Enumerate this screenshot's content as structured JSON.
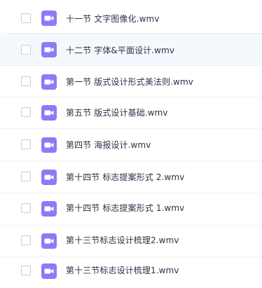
{
  "file_list": {
    "icon": "video-file-icon",
    "icon_color": "#8b7cf6",
    "highlight_color": "#f5f9fe",
    "files": [
      {
        "name": "十一节 文字图像化.wmv"
      },
      {
        "name": "十二节 字体&平面设计.wmv",
        "highlighted": true
      },
      {
        "name": "第一节 版式设计形式美法则.wmv"
      },
      {
        "name": "第五节 版式设计基础.wmv"
      },
      {
        "name": "第四节 海报设计.wmv"
      },
      {
        "name": "第十四节 标志提案形式 2.wmv"
      },
      {
        "name": "第十四节 标志提案形式 1.wmv"
      },
      {
        "name": "第十三节标志设计梳理2.wmv"
      },
      {
        "name": "第十三节标志设计梳理1.wmv"
      }
    ]
  }
}
